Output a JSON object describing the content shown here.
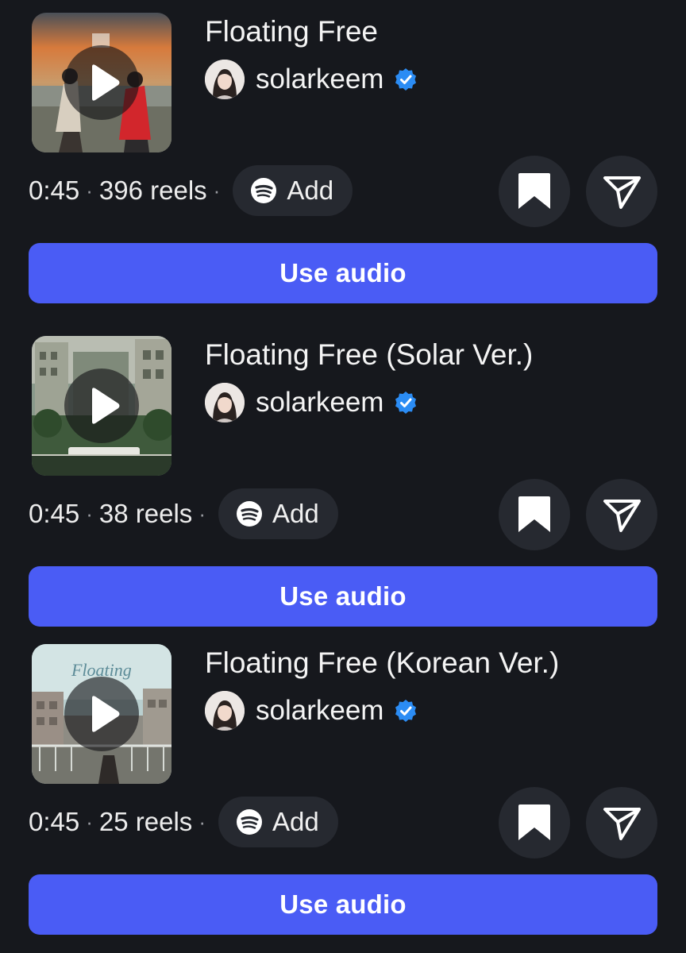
{
  "tracks": [
    {
      "title": "Floating Free",
      "artist": "solarkeem",
      "duration": "0:45",
      "reels": "396 reels",
      "add_label": "Add",
      "use_audio_label": "Use audio"
    },
    {
      "title": "Floating Free (Solar Ver.)",
      "artist": "solarkeem",
      "duration": "0:45",
      "reels": "38 reels",
      "add_label": "Add",
      "use_audio_label": "Use audio"
    },
    {
      "title": "Floating Free (Korean Ver.)",
      "artist": "solarkeem",
      "duration": "0:45",
      "reels": "25 reels",
      "add_label": "Add",
      "use_audio_label": "Use audio"
    }
  ],
  "separator": "·",
  "cover_wordmark": "Floating",
  "icons": {
    "play": "play-icon",
    "verified": "verified-badge-icon",
    "spotify": "spotify-icon",
    "save": "bookmark-icon",
    "share": "paper-plane-icon"
  },
  "colors": {
    "background": "#16181d",
    "button_dark": "#262930",
    "accent_blue": "#4a5cf5",
    "verified_blue": "#2b8cf4"
  }
}
